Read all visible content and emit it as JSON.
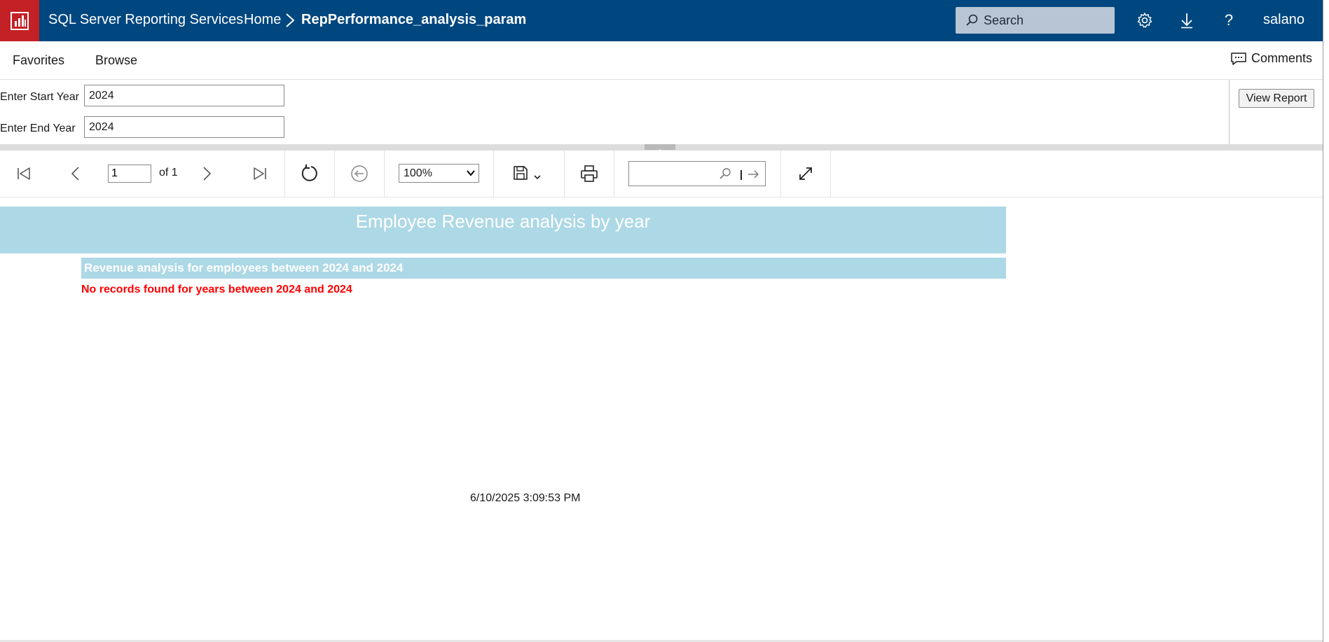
{
  "topbar": {
    "app_title": "SQL Server Reporting Services",
    "breadcrumb_home": "Home",
    "breadcrumb_report": "RepPerformance_analysis_param",
    "search_placeholder": "Search",
    "username": "salano",
    "help_label": "?",
    "brand_color": "#00477f",
    "logo_color": "#c42126"
  },
  "nav": {
    "favorites": "Favorites",
    "browse": "Browse",
    "comments": "Comments"
  },
  "params": {
    "start_label": "Enter Start Year",
    "start_value": "2024",
    "end_label": "Enter End Year",
    "end_value": "2024",
    "view_report": "View Report"
  },
  "toolbar": {
    "page_value": "1",
    "page_of": "of 1",
    "zoom": "100%"
  },
  "report": {
    "title": "Employee Revenue analysis by year",
    "subtitle": "Revenue analysis for employees between 2024 and 2024",
    "no_records": "No records found for years between 2024 and 2024",
    "timestamp": "6/10/2025 3:09:53 PM",
    "header_color": "#add8e6",
    "error_color": "#ff0000"
  }
}
